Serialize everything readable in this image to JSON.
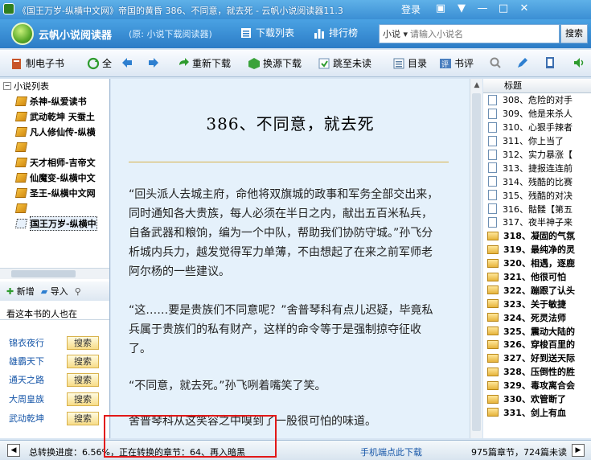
{
  "window": {
    "title": "《国王万岁-纵横中文网》帝国的黄昏 386、不同意，就去死 - 云帆小说阅读器11.3",
    "login": "登录"
  },
  "header": {
    "brand": "云帆小说阅读器",
    "brand_sub": "(原: 小说下载阅读器)",
    "download_list": "下载列表",
    "ranking": "排行榜",
    "search_category": "小说",
    "search_placeholder": "请输入小说名",
    "search_button": "搜索"
  },
  "toolbar": {
    "make_ebook": "制电子书",
    "all": "全",
    "redownload": "重新下载",
    "change_source": "换源下载",
    "jump_unread": "跳至未读",
    "toc": "目录",
    "review": "书评"
  },
  "sidebar": {
    "header": "小说列表",
    "books": [
      "杀神-纵爱读书",
      "武动乾坤 天蚕土",
      "凡人修仙传-纵横",
      "",
      "天才相师-吉帝文",
      "仙魔变-纵横中文",
      "圣王-纵横中文网",
      "",
      "国王万岁-纵横中"
    ],
    "add": "新增",
    "import": "导入",
    "also_reading": "看这本书的人也在",
    "recommendations": [
      {
        "name": "锦衣夜行",
        "button": "搜索"
      },
      {
        "name": "雄霸天下",
        "button": "搜索"
      },
      {
        "name": "通天之路",
        "button": "搜索"
      },
      {
        "name": "大周皇族",
        "button": "搜索"
      },
      {
        "name": "武动乾坤",
        "button": "搜索"
      }
    ]
  },
  "reader": {
    "chapter_title": "386、不同意，就去死",
    "paragraphs": [
      "“回头派人去城主府，命他将双旗城的政事和军务全部交出来，同时通知各大贵族，每人必须在半日之内，献出五百米私兵，自备武器和粮饷，编为一个中队，帮助我们协防守城。”孙飞分析城内兵力，越发觉得军力单薄，不由想起了在来之前军师老阿尔杨的一些建议。",
      "“这……要是贵族们不同意呢？”舍普琴科有点儿迟疑，毕竟私兵属于贵族们的私有财产，这样的命令等于是强制掠夺征收了。",
      "“不同意，就去死。”孙飞咧着嘴笑了笑。",
      "舍普琴科从这笑容之中嗅到了一股很可怕的味道。"
    ]
  },
  "chapters": {
    "header": "标题",
    "items": [
      {
        "title": "308、危险的对手",
        "read": true
      },
      {
        "title": "309、他是来杀人",
        "read": true
      },
      {
        "title": "310、心狠手辣者",
        "read": true
      },
      {
        "title": "311、你上当了",
        "read": true
      },
      {
        "title": "312、实力暴涨【",
        "read": true
      },
      {
        "title": "313、捷报连连前",
        "read": true
      },
      {
        "title": "314、残酷的比赛",
        "read": true
      },
      {
        "title": "315、残酷的对决",
        "read": true
      },
      {
        "title": "316、骷髅【第五",
        "read": true
      },
      {
        "title": "317、夜半神子来",
        "read": true
      },
      {
        "title": "318、凝固的气氛",
        "read": false
      },
      {
        "title": "319、最纯净的灵",
        "read": false
      },
      {
        "title": "320、相遇，逐鹿",
        "read": false
      },
      {
        "title": "321、他很可怕",
        "read": false
      },
      {
        "title": "322、蹦跟了认头",
        "read": false
      },
      {
        "title": "323、关于敏捷",
        "read": false
      },
      {
        "title": "324、死灵法师",
        "read": false
      },
      {
        "title": "325、震动大陆的",
        "read": false
      },
      {
        "title": "326、穿梭百里的",
        "read": false
      },
      {
        "title": "327、好到送天际",
        "read": false
      },
      {
        "title": "328、压倒性的胜",
        "read": false
      },
      {
        "title": "329、毒攻离合会",
        "read": false
      },
      {
        "title": "330、欢管断了",
        "read": false
      },
      {
        "title": "331、剑上有血",
        "read": false
      }
    ]
  },
  "status": {
    "progress": "总转换进度：6.56%，正在转换的章节：64、再入暗黑",
    "mobile_download": "手机端点此下载",
    "counts": "975篇章节，724篇未读"
  }
}
